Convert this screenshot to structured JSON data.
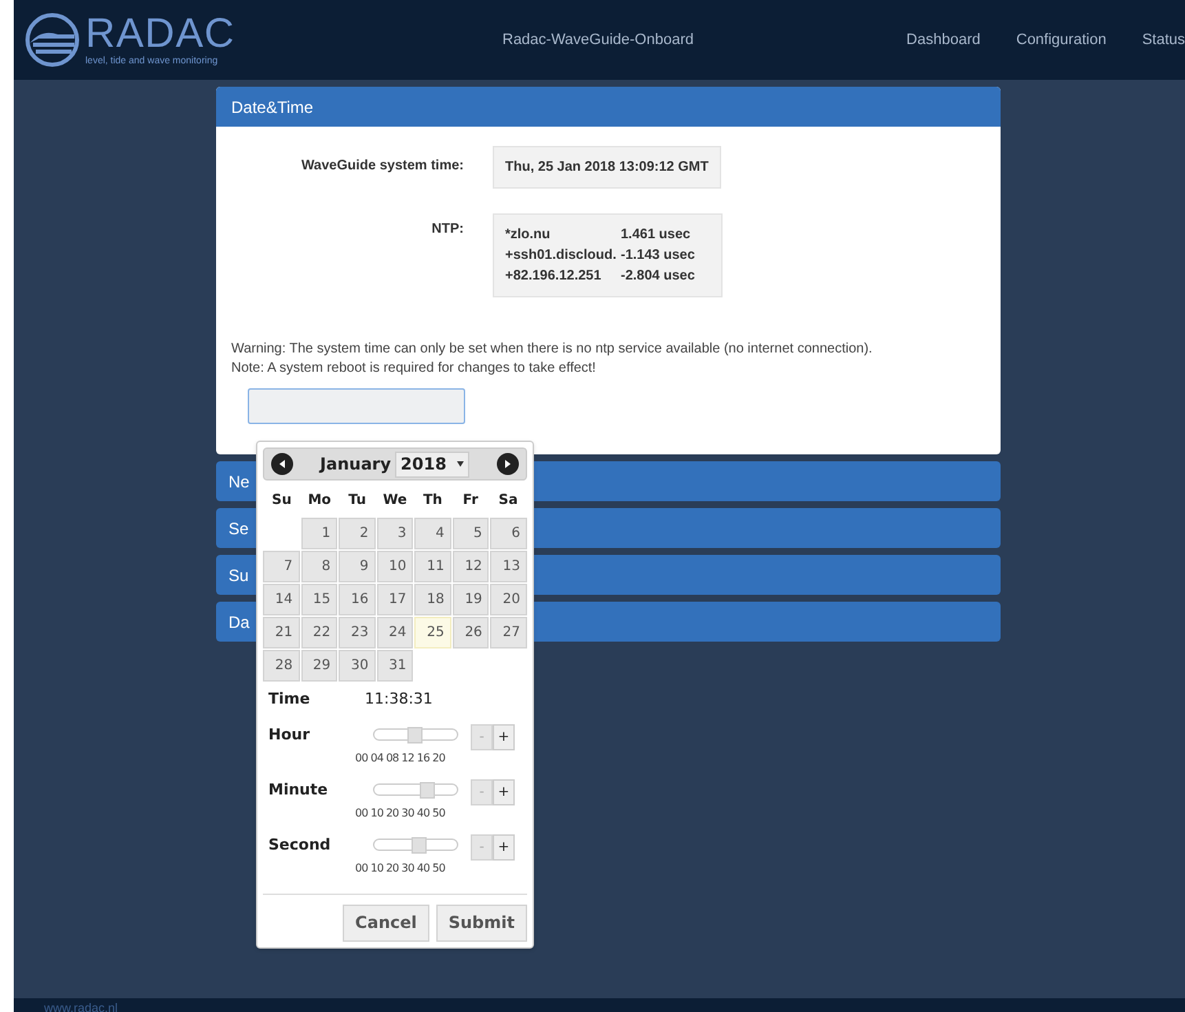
{
  "header": {
    "logo_text": "RADAC",
    "tagline": "level, tide and wave monitoring",
    "title": "Radac-WaveGuide-Onboard",
    "nav": [
      {
        "label": "Dashboard"
      },
      {
        "label": "Configuration"
      },
      {
        "label": "Status"
      }
    ]
  },
  "panel": {
    "title": "Date&Time",
    "system_time_label": "WaveGuide system time:",
    "system_time": "Thu, 25 Jan 2018 13:09:12 GMT",
    "ntp_label": "NTP:",
    "ntp_rows": [
      {
        "host": "*zlo.nu",
        "offset": "1.461 usec"
      },
      {
        "host": "+ssh01.discloud.",
        "offset": "-1.143 usec"
      },
      {
        "host": "+82.196.12.251",
        "offset": "-2.804 usec"
      }
    ],
    "warning": "Warning: The system time can only be set when there is no ntp service available (no internet connection).",
    "note": "Note: A system reboot is required for changes to take effect!"
  },
  "collapsed_panels": [
    {
      "title": "Ne"
    },
    {
      "title": "Se"
    },
    {
      "title": "Su"
    },
    {
      "title": "Da"
    }
  ],
  "datepicker": {
    "month": "January",
    "year": "2018",
    "weekdays": [
      "Su",
      "Mo",
      "Tu",
      "We",
      "Th",
      "Fr",
      "Sa"
    ],
    "weeks": [
      [
        {
          "day": "1",
          "today": false
        },
        {
          "day": "2",
          "today": false
        },
        {
          "day": "3",
          "today": false
        },
        {
          "day": "4",
          "today": false
        },
        {
          "day": "5",
          "today": false
        },
        {
          "day": "6",
          "today": false
        }
      ],
      [
        {
          "day": "7",
          "today": false
        },
        {
          "day": "8",
          "today": false
        },
        {
          "day": "9",
          "today": false
        },
        {
          "day": "10",
          "today": false
        },
        {
          "day": "11",
          "today": false
        },
        {
          "day": "12",
          "today": false
        },
        {
          "day": "13",
          "today": false
        }
      ],
      [
        {
          "day": "14",
          "today": false
        },
        {
          "day": "15",
          "today": false
        },
        {
          "day": "16",
          "today": false
        },
        {
          "day": "17",
          "today": false
        },
        {
          "day": "18",
          "today": false
        },
        {
          "day": "19",
          "today": false
        },
        {
          "day": "20",
          "today": false
        }
      ],
      [
        {
          "day": "21",
          "today": false
        },
        {
          "day": "22",
          "today": false
        },
        {
          "day": "23",
          "today": false
        },
        {
          "day": "24",
          "today": false
        },
        {
          "day": "25",
          "today": true
        },
        {
          "day": "26",
          "today": false
        },
        {
          "day": "27",
          "today": false
        }
      ],
      [
        {
          "day": "28",
          "today": false
        },
        {
          "day": "29",
          "today": false
        },
        {
          "day": "30",
          "today": false
        },
        {
          "day": "31",
          "today": false
        }
      ]
    ],
    "time_label": "Time",
    "time_value": "11:38:31",
    "sliders": [
      {
        "label": "Hour",
        "level": 0.48,
        "ticks": "00 04 08 12 16 20",
        "minus": "-",
        "plus": "+"
      },
      {
        "label": "Minute",
        "level": 0.64,
        "ticks": "00 10 20 30 40 50",
        "minus": "-",
        "plus": "+"
      },
      {
        "label": "Second",
        "level": 0.53,
        "ticks": "00 10 20 30 40 50",
        "minus": "-",
        "plus": "+"
      }
    ],
    "buttons": [
      "Cancel",
      "Submit"
    ]
  },
  "footer": {
    "link": "www.radac.nl"
  }
}
